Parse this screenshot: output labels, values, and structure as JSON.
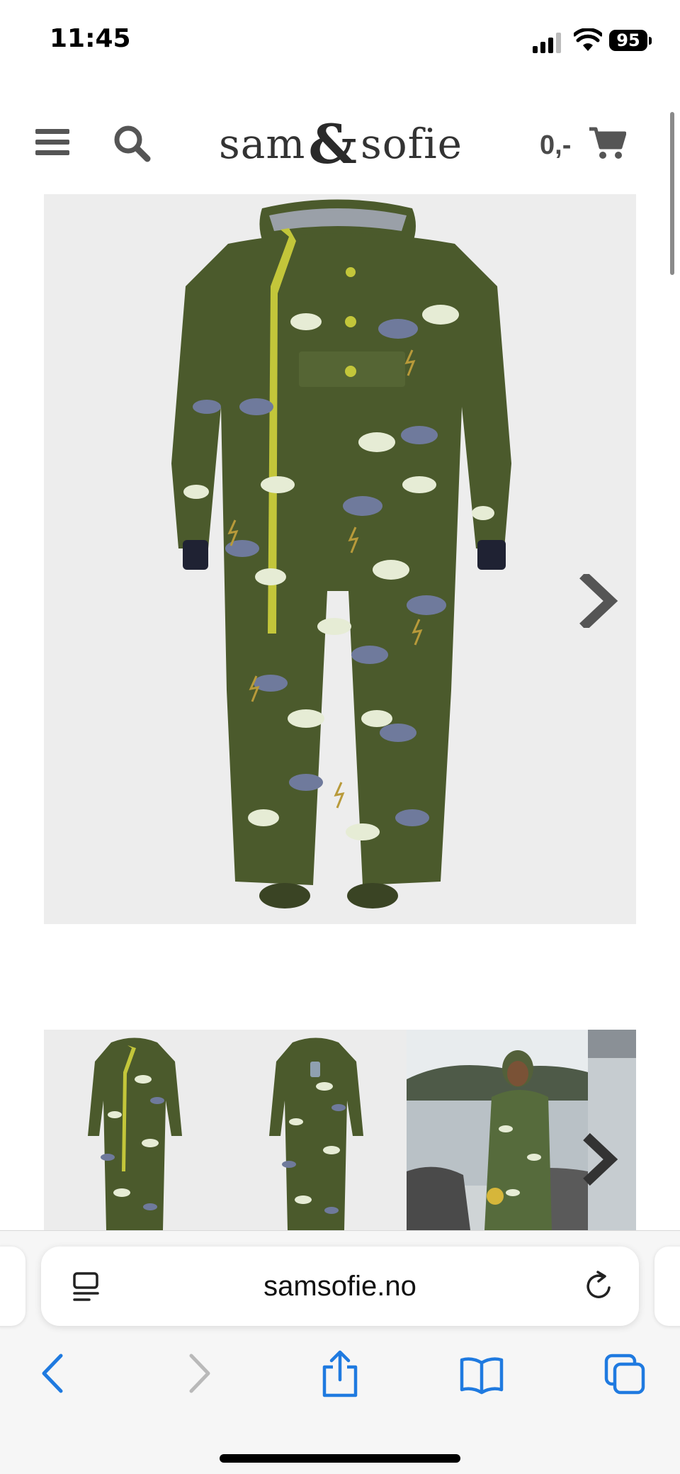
{
  "status_bar": {
    "time": "11:45",
    "battery": "95"
  },
  "header": {
    "logo_left": "sam",
    "logo_amp": "&",
    "logo_right": "sofie",
    "cart_total": "0,-"
  },
  "icons": {
    "menu": "menu-icon",
    "search": "search-icon",
    "cart": "cart-icon",
    "next": "chevron-right-icon",
    "reader": "reader-icon",
    "reload": "reload-icon",
    "back": "back-icon",
    "forward": "forward-icon",
    "share": "share-icon",
    "bookmarks": "bookmarks-icon",
    "tabs": "tabs-icon"
  },
  "browser": {
    "url": "samsofie.no"
  },
  "colors": {
    "suit_green": "#4b5a2c",
    "zipper_yellow": "#c3c63a",
    "safari_blue": "#1f7ae0",
    "forward_disabled": "#b9b9b9"
  }
}
